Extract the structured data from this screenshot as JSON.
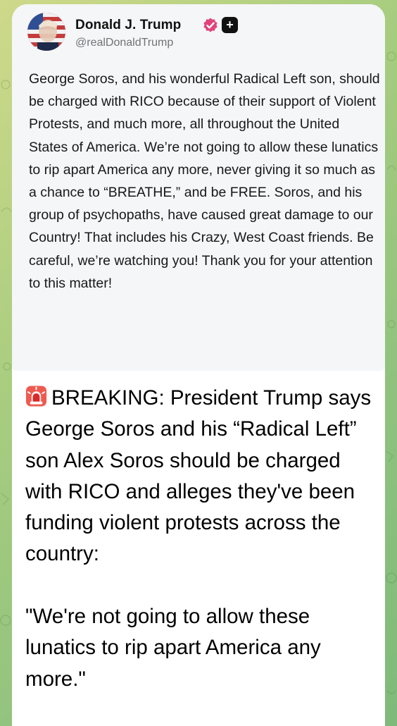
{
  "post": {
    "display_name": "Donald J. Trump",
    "handle": "@realDonaldTrump",
    "badges": [
      "verified-badge-icon",
      "plus-badge-icon"
    ],
    "body": "George Soros, and his wonderful Radical Left son, should be charged with RICO because of their support of Violent Protests, and much more, all throughout the United States of America. We’re not going to allow these lunatics to rip apart America any more, never giving it so much as a chance to “BREATHE,” and be FREE. Soros, and his group of psychopaths, have caused great damage to our Country! That includes his Crazy, West Coast friends. Be careful, we’re watching you! Thank you for your attention to this matter!"
  },
  "message": {
    "icon": "siren-icon",
    "text": "BREAKING: President Trump says George Soros and his “Radical Left” son Alex Soros should be charged with RICO and alleges they've been funding violent protests across the country:\n\n\"We're not going to allow these lunatics to rip apart America any more.\""
  },
  "colors": {
    "bubble": "#ffffff",
    "embed_background": "#f5f6f7",
    "verified": "#e0457b",
    "wallpaper": "#a9cd7f"
  }
}
